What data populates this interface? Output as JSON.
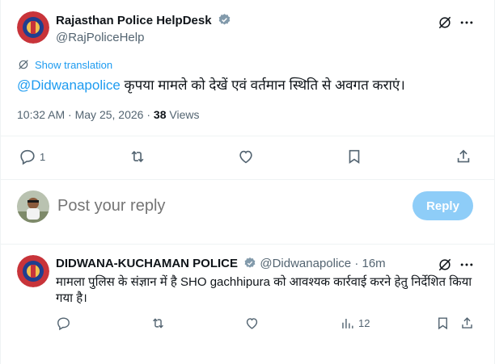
{
  "tweet": {
    "author_name": "Rajasthan Police HelpDesk",
    "author_handle": "@RajPoliceHelp",
    "translate_label": "Show translation",
    "mention": "@Didwanapolice",
    "text": " कृपया मामले को देखें एवं वर्तमान स्थिति से अवगत कराएं।",
    "time": "10:32 AM",
    "date": "May 25, 2026",
    "views_count": "38",
    "views_label": "Views",
    "reply_count": "1"
  },
  "compose": {
    "placeholder": "Post your reply",
    "button_label": "Reply"
  },
  "reply": {
    "author_name": "DIDWANA-KUCHAMAN POLICE",
    "author_handle": "@Didwanapolice",
    "time_ago": "16m",
    "text": "मामला पुलिस के संज्ञान में है SHO gachhipura को आवश्यक कार्रवाई करने हेतु निर्देशित किया गया है।",
    "views": "12"
  },
  "colors": {
    "accent": "#1d9bf0",
    "muted": "#536471",
    "reply_button": "#8ecdf8"
  }
}
